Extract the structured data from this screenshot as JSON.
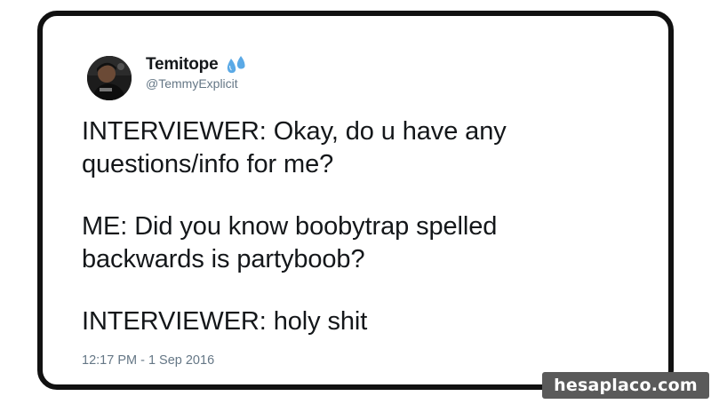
{
  "tweet": {
    "author": {
      "display_name": "Temitope",
      "handle": "@TemmyExplicit",
      "avatar_icon": "profile-photo-avatar",
      "name_emoji_icon": "sweat-droplets-emoji"
    },
    "paragraphs": [
      "INTERVIEWER: Okay, do u have any\nquestions/info for me?",
      "ME: Did you know boobytrap spelled\nbackwards is partyboob?",
      "INTERVIEWER: holy shit"
    ],
    "timestamp": "12:17 PM - 1 Sep 2016"
  },
  "watermark": {
    "text": "hesaplaco.com"
  },
  "colors": {
    "card_border": "#111111",
    "text_primary": "#14171a",
    "text_secondary": "#657786",
    "emoji_blue": "#5aa9e6",
    "watermark_bg": "#5a5a5a"
  }
}
